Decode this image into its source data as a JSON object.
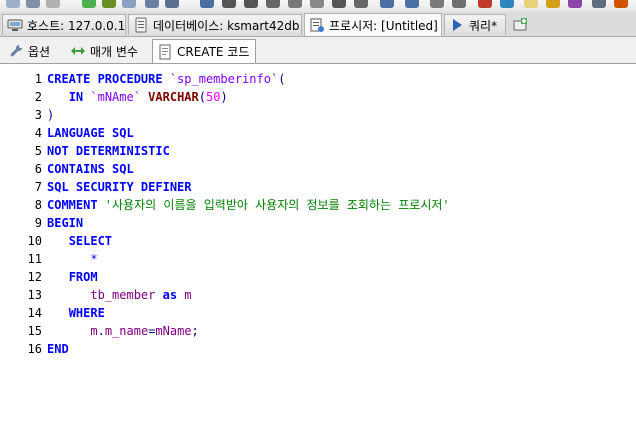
{
  "connection_tabs": [
    {
      "icon": "server-icon",
      "label": "호스트: 127.0.0.1"
    },
    {
      "icon": "database-icon",
      "label": "데이터베이스: ksmart42db"
    },
    {
      "icon": "procedure-icon",
      "label": "프로시저: [Untitled]"
    },
    {
      "icon": "play-icon",
      "label": "쿼리*"
    },
    {
      "icon": "new-tab-icon",
      "label": ""
    }
  ],
  "sub_tabs": [
    {
      "icon": "wrench-icon",
      "label": "옵션"
    },
    {
      "icon": "arrows-icon",
      "label": "매개 변수"
    },
    {
      "icon": "document-icon",
      "label": "CREATE 코드"
    }
  ],
  "code_lines": [
    {
      "n": "1",
      "tokens": [
        [
          "kw",
          "CREATE PROCEDURE "
        ],
        [
          "bq",
          "`sp_memberinfo`"
        ],
        [
          "op",
          "("
        ]
      ]
    },
    {
      "n": "2",
      "tokens": [
        [
          "",
          "   "
        ],
        [
          "kw",
          "IN "
        ],
        [
          "bq",
          "`mNAme` "
        ],
        [
          "dt",
          "VARCHAR"
        ],
        [
          "op",
          "("
        ],
        [
          "num",
          "50"
        ],
        [
          "op",
          ")"
        ]
      ]
    },
    {
      "n": "3",
      "tokens": [
        [
          "op",
          ")"
        ]
      ]
    },
    {
      "n": "4",
      "tokens": [
        [
          "kw",
          "LANGUAGE SQL"
        ]
      ]
    },
    {
      "n": "5",
      "tokens": [
        [
          "kw",
          "NOT DETERMINISTIC"
        ]
      ]
    },
    {
      "n": "6",
      "tokens": [
        [
          "kw",
          "CONTAINS SQL"
        ]
      ]
    },
    {
      "n": "7",
      "tokens": [
        [
          "kw",
          "SQL SECURITY DEFINER"
        ]
      ]
    },
    {
      "n": "8",
      "tokens": [
        [
          "kw",
          "COMMENT "
        ],
        [
          "str",
          "'사용자의 이름을 입력받아 사용자의 정보를 조회하는 프로시저'"
        ]
      ]
    },
    {
      "n": "9",
      "tokens": [
        [
          "kw",
          "BEGIN"
        ]
      ]
    },
    {
      "n": "10",
      "tokens": [
        [
          "",
          "   "
        ],
        [
          "kw",
          "SELECT"
        ]
      ]
    },
    {
      "n": "11",
      "tokens": [
        [
          "",
          "      "
        ],
        [
          "star",
          "*"
        ]
      ]
    },
    {
      "n": "12",
      "tokens": [
        [
          "",
          "   "
        ],
        [
          "kw",
          "FROM"
        ]
      ]
    },
    {
      "n": "13",
      "tokens": [
        [
          "",
          "      "
        ],
        [
          "id",
          "tb_member "
        ],
        [
          "kw",
          "as "
        ],
        [
          "id",
          "m"
        ]
      ]
    },
    {
      "n": "14",
      "tokens": [
        [
          "",
          "   "
        ],
        [
          "kw",
          "WHERE"
        ]
      ]
    },
    {
      "n": "15",
      "tokens": [
        [
          "",
          "      "
        ],
        [
          "id",
          "m"
        ],
        [
          "op",
          "."
        ],
        [
          "id",
          "m_name"
        ],
        [
          "op",
          "="
        ],
        [
          "id",
          "mName"
        ],
        [
          "op",
          ";"
        ]
      ]
    },
    {
      "n": "16",
      "tokens": [
        [
          "kw",
          "END"
        ]
      ]
    }
  ]
}
